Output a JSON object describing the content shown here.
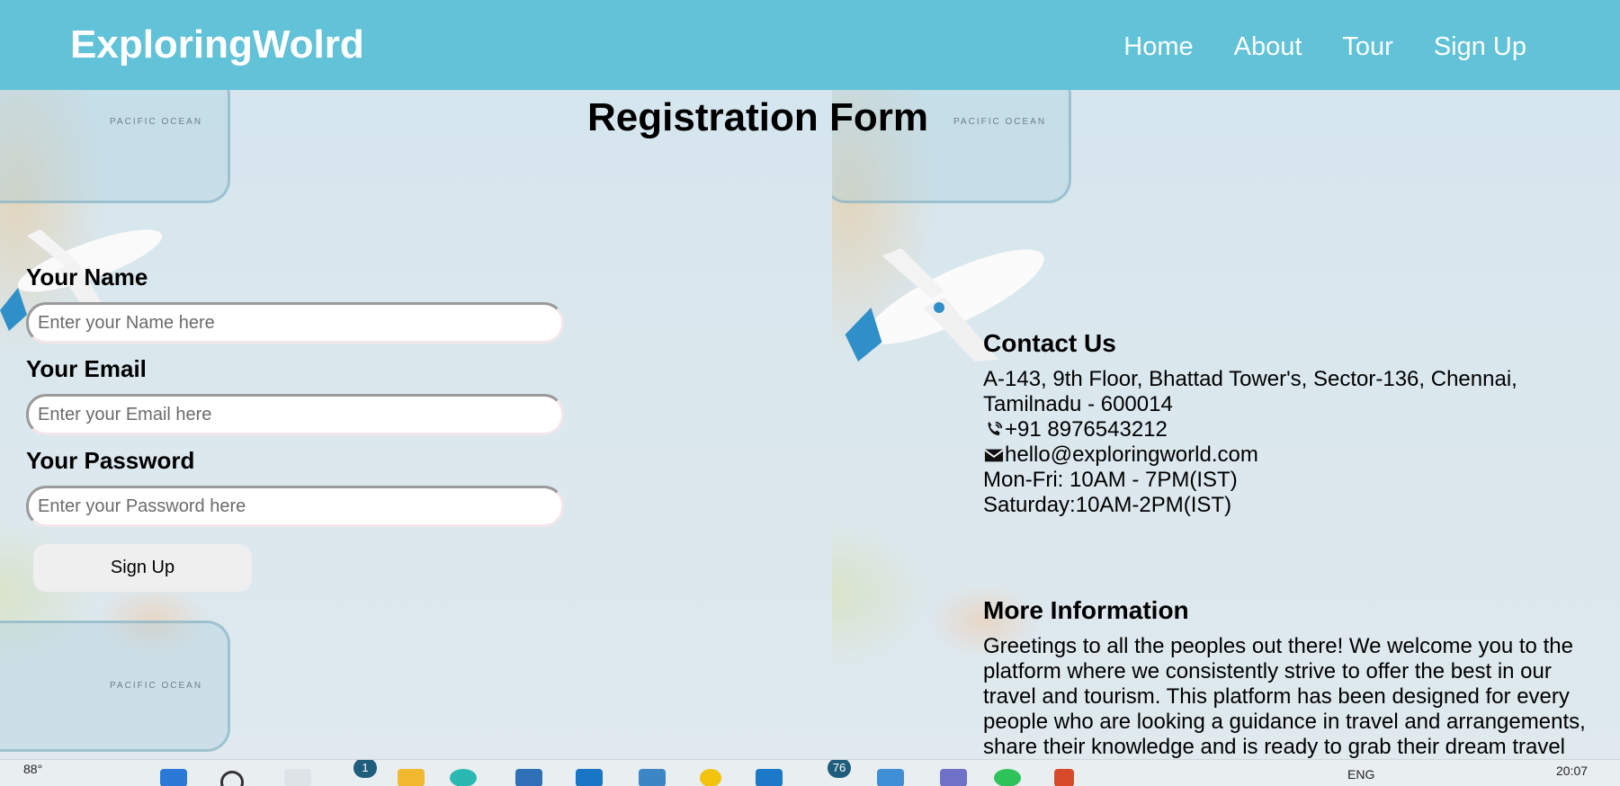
{
  "header": {
    "brand": "ExploringWolrd",
    "nav": [
      "Home",
      "About",
      "Tour",
      "Sign Up"
    ]
  },
  "form": {
    "title": "Registration Form",
    "fields": [
      {
        "label": "Your Name",
        "placeholder": "Enter your Name here"
      },
      {
        "label": "Your Email",
        "placeholder": "Enter your Email here"
      },
      {
        "label": "Your Password",
        "placeholder": "Enter your Password here"
      }
    ],
    "submit_label": "Sign Up"
  },
  "background": {
    "ocean_label": "PACIFIC OCEAN"
  },
  "contact": {
    "heading": "Contact Us",
    "address": "A-143, 9th Floor, Bhattad Tower's, Sector-136, Chennai, Tamilnadu - 600014",
    "phone": "+91 8976543212",
    "email": "hello@exploringworld.com",
    "hours_weekday": "Mon-Fri: 10AM - 7PM(IST)",
    "hours_saturday": "Saturday:10AM-2PM(IST)",
    "phone_icon": "phone-icon",
    "email_icon": "envelope-icon"
  },
  "info": {
    "heading": "More Information",
    "text": "Greetings to all the peoples out there! We welcome you to the platform where we consistently strive to offer the best in our travel and tourism. This platform has been designed for every people who are looking a guidance in travel and arrangements, share their knowledge and is ready to grab their dream travel"
  },
  "taskbar": {
    "weather": "88°",
    "badge_one": "1",
    "badge_two": "76",
    "language": "ENG",
    "time": "20:07"
  },
  "colors": {
    "header_bg": "#61c2d8",
    "page_bg": "#dce9ef"
  }
}
